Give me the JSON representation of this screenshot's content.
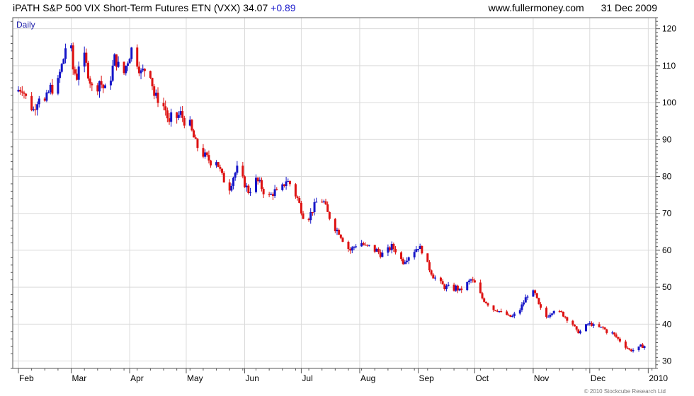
{
  "header": {
    "title": "iPATH S&P 500 VIX Short-Term Futures ETN (VXX) 34.07",
    "change": "+0.89",
    "website": "www.fullermoney.com",
    "date": "31 Dec 2009"
  },
  "footer": {
    "copyright": "© 2010 Stockcube Research Ltd"
  },
  "colors": {
    "up": "#1515c8",
    "down": "#dd1111",
    "grid": "#dadada",
    "frame": "#555555",
    "period_label": "#2222aa"
  },
  "chart_data": {
    "type": "candlestick",
    "period_label": "Daily",
    "x_ticks": [
      {
        "label": "Feb",
        "day": 0
      },
      {
        "label": "Mar",
        "day": 28
      },
      {
        "label": "Apr",
        "day": 59
      },
      {
        "label": "May",
        "day": 89
      },
      {
        "label": "Jun",
        "day": 120
      },
      {
        "label": "Jul",
        "day": 150
      },
      {
        "label": "Aug",
        "day": 181
      },
      {
        "label": "Sep",
        "day": 212
      },
      {
        "label": "Oct",
        "day": 242
      },
      {
        "label": "Nov",
        "day": 273
      },
      {
        "label": "Dec",
        "day": 303
      },
      {
        "label": "2010",
        "day": 334
      }
    ],
    "x_range_days": [
      -3,
      338
    ],
    "ylim": [
      28,
      123
    ],
    "y_ticks": [
      30,
      40,
      50,
      60,
      70,
      80,
      90,
      100,
      110,
      120
    ],
    "y_axis_side": "right",
    "grid": true,
    "close_path": [
      [
        -2,
        103
      ],
      [
        2,
        104
      ],
      [
        5,
        100
      ],
      [
        8,
        98
      ],
      [
        11,
        102
      ],
      [
        14,
        100
      ],
      [
        17,
        104
      ],
      [
        20,
        103
      ],
      [
        22,
        108
      ],
      [
        24,
        112
      ],
      [
        25,
        115
      ],
      [
        26,
        110
      ],
      [
        28,
        114
      ],
      [
        29,
        109
      ],
      [
        31,
        107
      ],
      [
        33,
        114
      ],
      [
        35,
        112
      ],
      [
        37,
        108
      ],
      [
        39,
        104
      ],
      [
        41,
        103
      ],
      [
        43,
        106
      ],
      [
        45,
        104
      ],
      [
        47,
        103
      ],
      [
        49,
        107
      ],
      [
        51,
        112
      ],
      [
        53,
        110
      ],
      [
        55,
        106
      ],
      [
        57,
        110
      ],
      [
        59,
        113
      ],
      [
        61,
        116
      ],
      [
        63,
        111
      ],
      [
        65,
        108
      ],
      [
        67,
        109
      ],
      [
        69,
        110
      ],
      [
        70,
        108
      ],
      [
        72,
        102
      ],
      [
        74,
        101
      ],
      [
        76,
        100
      ],
      [
        78,
        98
      ],
      [
        80,
        94
      ],
      [
        82,
        98
      ],
      [
        84,
        96
      ],
      [
        86,
        97
      ],
      [
        88,
        95
      ],
      [
        90,
        96
      ],
      [
        92,
        92
      ],
      [
        94,
        89
      ],
      [
        96,
        87
      ],
      [
        98,
        86
      ],
      [
        100,
        85
      ],
      [
        102,
        84
      ],
      [
        104,
        86
      ],
      [
        106,
        83
      ],
      [
        108,
        80
      ],
      [
        110,
        78
      ],
      [
        112,
        77
      ],
      [
        114,
        80
      ],
      [
        116,
        82
      ],
      [
        118,
        80
      ],
      [
        120,
        78
      ],
      [
        122,
        76
      ],
      [
        124,
        77
      ],
      [
        126,
        79
      ],
      [
        128,
        78
      ],
      [
        130,
        76
      ],
      [
        132,
        74
      ],
      [
        134,
        75
      ],
      [
        136,
        76
      ],
      [
        138,
        75
      ],
      [
        140,
        77
      ],
      [
        142,
        79
      ],
      [
        144,
        78
      ],
      [
        146,
        76
      ],
      [
        148,
        74
      ],
      [
        150,
        71
      ],
      [
        152,
        68
      ],
      [
        154,
        69
      ],
      [
        156,
        71
      ],
      [
        158,
        73
      ],
      [
        160,
        74
      ],
      [
        162,
        73
      ],
      [
        164,
        70
      ],
      [
        166,
        68
      ],
      [
        168,
        66
      ],
      [
        170,
        65
      ],
      [
        172,
        63
      ],
      [
        174,
        61
      ],
      [
        176,
        60
      ],
      [
        178,
        61
      ],
      [
        180,
        62
      ],
      [
        182,
        62
      ],
      [
        184,
        61
      ],
      [
        186,
        61
      ],
      [
        188,
        60
      ],
      [
        190,
        60
      ],
      [
        192,
        59
      ],
      [
        194,
        59
      ],
      [
        196,
        60
      ],
      [
        198,
        61
      ],
      [
        200,
        60
      ],
      [
        202,
        58
      ],
      [
        204,
        57
      ],
      [
        206,
        58
      ],
      [
        208,
        59
      ],
      [
        210,
        60
      ],
      [
        212,
        61
      ],
      [
        214,
        60
      ],
      [
        216,
        57
      ],
      [
        218,
        55
      ],
      [
        220,
        53
      ],
      [
        222,
        52
      ],
      [
        224,
        51
      ],
      [
        226,
        50
      ],
      [
        228,
        50
      ],
      [
        230,
        49
      ],
      [
        232,
        50
      ],
      [
        234,
        49
      ],
      [
        236,
        50
      ],
      [
        238,
        51
      ],
      [
        240,
        52
      ],
      [
        242,
        51
      ],
      [
        244,
        49
      ],
      [
        246,
        47
      ],
      [
        248,
        46
      ],
      [
        250,
        45
      ],
      [
        252,
        44
      ],
      [
        254,
        44
      ],
      [
        256,
        43
      ],
      [
        258,
        43
      ],
      [
        260,
        42
      ],
      [
        262,
        42
      ],
      [
        264,
        43
      ],
      [
        266,
        44
      ],
      [
        268,
        46
      ],
      [
        270,
        48
      ],
      [
        272,
        49
      ],
      [
        274,
        48
      ],
      [
        276,
        45
      ],
      [
        278,
        43
      ],
      [
        280,
        42
      ],
      [
        282,
        43
      ],
      [
        284,
        44
      ],
      [
        286,
        43
      ],
      [
        288,
        43
      ],
      [
        290,
        42
      ],
      [
        292,
        41
      ],
      [
        294,
        40
      ],
      [
        296,
        38
      ],
      [
        298,
        38
      ],
      [
        300,
        39
      ],
      [
        302,
        40
      ],
      [
        304,
        40
      ],
      [
        306,
        39
      ],
      [
        308,
        39
      ],
      [
        310,
        39
      ],
      [
        312,
        38
      ],
      [
        314,
        38
      ],
      [
        316,
        37
      ],
      [
        318,
        36
      ],
      [
        320,
        35
      ],
      [
        322,
        34
      ],
      [
        324,
        33
      ],
      [
        326,
        33
      ],
      [
        328,
        33
      ],
      [
        330,
        34
      ],
      [
        332,
        34.07
      ]
    ]
  }
}
